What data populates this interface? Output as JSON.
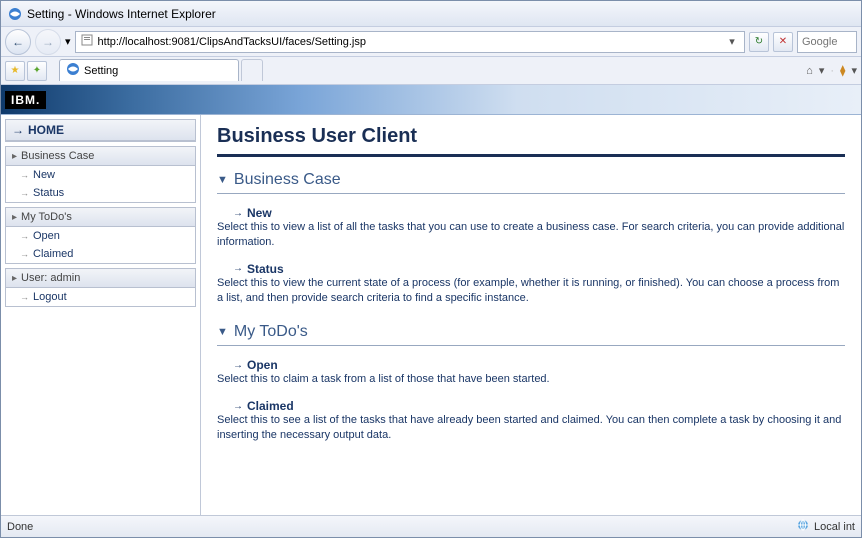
{
  "window": {
    "title": "Setting - Windows Internet Explorer"
  },
  "nav": {
    "url": "http://localhost:9081/ClipsAndTacksUI/faces/Setting.jsp",
    "search_placeholder": "Google"
  },
  "tab": {
    "title": "Setting"
  },
  "banner": {
    "logo": "IBM."
  },
  "sidebar": {
    "home": "HOME",
    "sections": [
      {
        "header": "Business Case",
        "items": [
          {
            "label": "New"
          },
          {
            "label": "Status"
          }
        ]
      },
      {
        "header": "My ToDo's",
        "items": [
          {
            "label": "Open"
          },
          {
            "label": "Claimed"
          }
        ]
      },
      {
        "header": "User: admin",
        "items": [
          {
            "label": "Logout"
          }
        ]
      }
    ]
  },
  "main": {
    "title": "Business User Client",
    "sections": [
      {
        "title": "Business Case",
        "items": [
          {
            "title": "New",
            "desc": "Select this to view a list of all the tasks that you can use to create a business case. For search criteria, you can provide additional information."
          },
          {
            "title": "Status",
            "desc": "Select this to view the current state of a process (for example, whether it is running, or finished). You can choose a process from a list, and then provide search criteria to find a specific instance."
          }
        ]
      },
      {
        "title": "My ToDo's",
        "items": [
          {
            "title": "Open",
            "desc": "Select this to claim a task from a list of those that have been started."
          },
          {
            "title": "Claimed",
            "desc": "Select this to see a list of the tasks that have already been started and claimed. You can then complete a task by choosing it and inserting the necessary output data."
          }
        ]
      }
    ]
  },
  "status": {
    "left": "Done",
    "right": "Local int"
  },
  "icons": {
    "ie": "e",
    "back": "←",
    "fwd": "→",
    "refresh": "↻",
    "stop": "✕",
    "favstar": "★",
    "addfav": "✦",
    "home": "⌂",
    "feed": "⧫",
    "drop": "▾",
    "twisty_open": "▼",
    "arrow_item": "→",
    "globe": "🌐"
  }
}
